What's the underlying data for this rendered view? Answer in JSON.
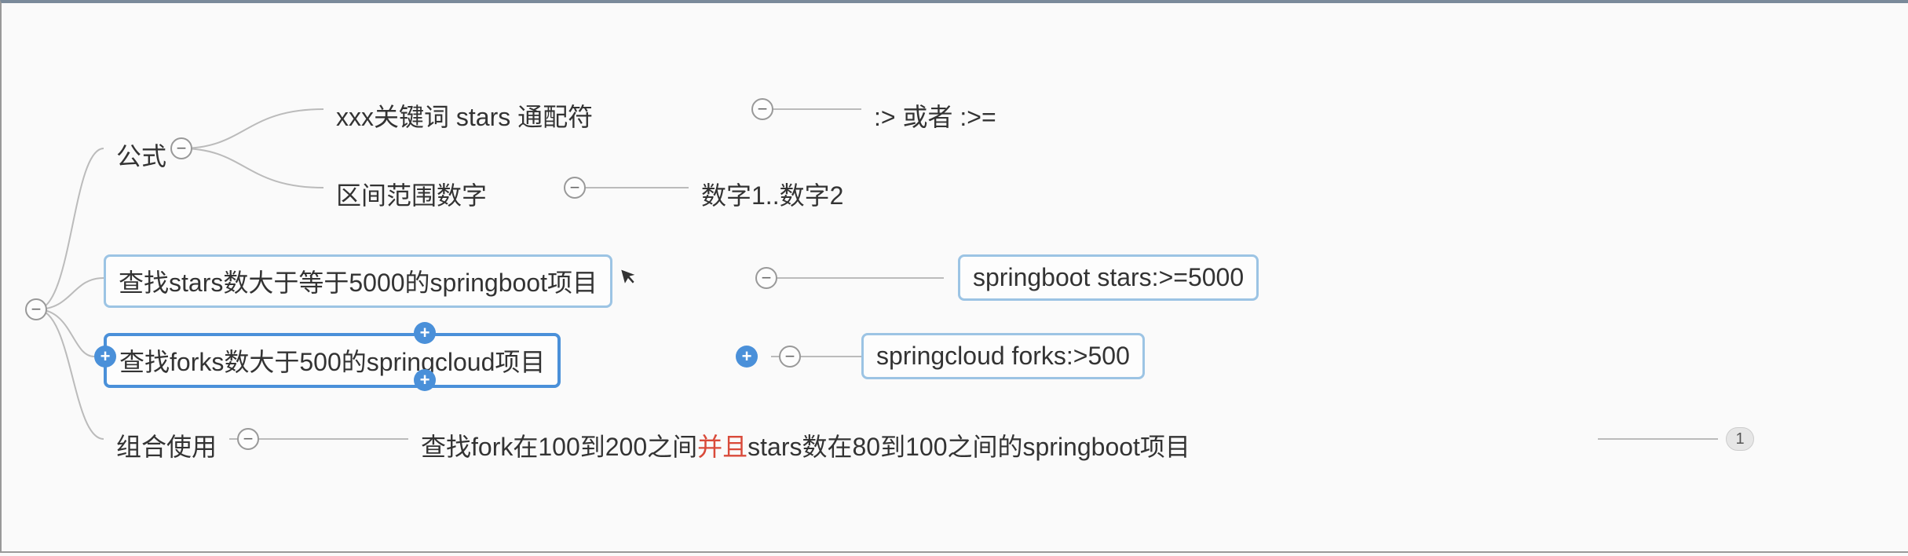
{
  "root": {
    "collapse": "−"
  },
  "nodes": {
    "formula": "公式",
    "keyword_pattern": "xxx关键词  stars  通配符",
    "operator_hint": ":>   或者 :>=",
    "range_numbers": "区间范围数字",
    "range_pattern": "数字1..数字2",
    "query_stars": "查找stars数大于等于5000的springboot项目",
    "result_stars": "springboot stars:>=5000",
    "query_forks": "查找forks数大于500的springcloud项目",
    "result_forks": "springcloud forks:>500",
    "combined_use": "组合使用",
    "combined_query_pre": "查找fork在100到200之间",
    "combined_query_highlight": "并且",
    "combined_query_post": "stars数在80到100之间的springboot项目"
  },
  "badges": {
    "combined_count": "1"
  }
}
